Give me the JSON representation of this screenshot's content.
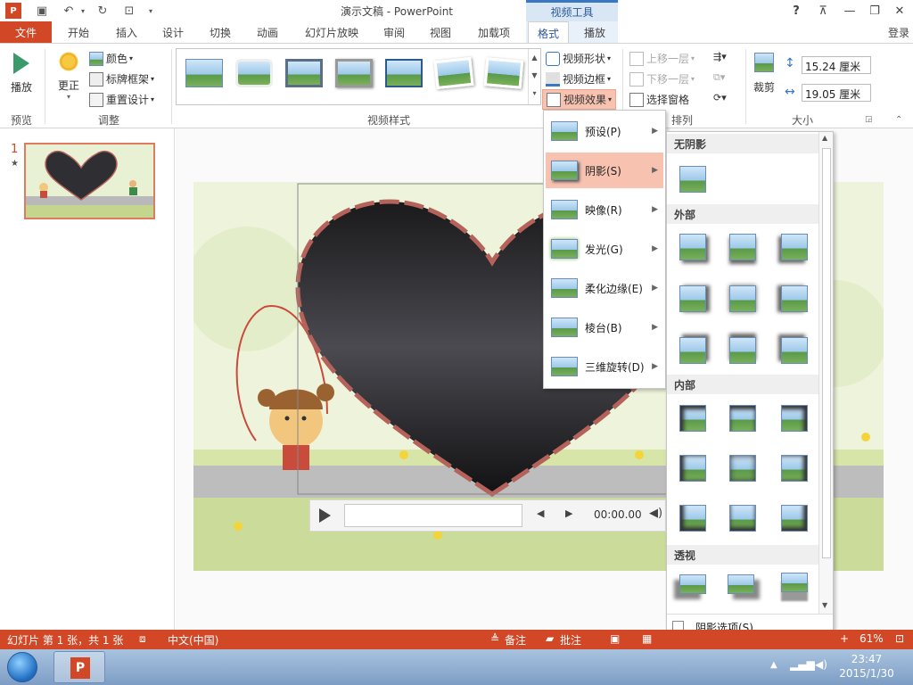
{
  "titlebar": {
    "title": "演示文稿 - PowerPoint",
    "context_tools": "视频工具",
    "help": "?"
  },
  "tabs": {
    "file": "文件",
    "home": "开始",
    "insert": "插入",
    "design": "设计",
    "transitions": "切换",
    "animations": "动画",
    "slideshow": "幻灯片放映",
    "review": "审阅",
    "view": "视图",
    "addins": "加载项",
    "format": "格式",
    "playback": "播放",
    "login": "登录"
  },
  "ribbon": {
    "preview": {
      "play": "播放",
      "group": "预览"
    },
    "adjust": {
      "correct": "更正",
      "color": "颜色",
      "poster": "标牌框架",
      "reset": "重置设计",
      "group": "调整"
    },
    "styles": {
      "group": "视频样式",
      "shape": "视频形状",
      "border": "视频边框",
      "effects": "视频效果"
    },
    "arrange": {
      "forward": "上移一层",
      "backward": "下移一层",
      "selection": "选择窗格",
      "group": "排列"
    },
    "size": {
      "crop": "裁剪",
      "height": "15.24 厘米",
      "width": "19.05 厘米",
      "group": "大小"
    }
  },
  "slides_pane": {
    "number": "1",
    "star": "★"
  },
  "player": {
    "time": "00:00.00"
  },
  "effects_menu": [
    {
      "label": "预设(P)"
    },
    {
      "label": "阴影(S)"
    },
    {
      "label": "映像(R)"
    },
    {
      "label": "发光(G)"
    },
    {
      "label": "柔化边缘(E)"
    },
    {
      "label": "棱台(B)"
    },
    {
      "label": "三维旋转(D)"
    }
  ],
  "shadow_panel": {
    "no_shadow": "无阴影",
    "outer": "外部",
    "inner": "内部",
    "perspective": "透视",
    "options": "阴影选项(S)..."
  },
  "statusbar": {
    "slide_info": "幻灯片 第 1 张，共 1 张",
    "language": "中文(中国)",
    "notes": "备注",
    "comments": "批注",
    "zoom": "61%"
  },
  "taskbar": {
    "time": "23:47",
    "date": "2015/1/30"
  },
  "colors": {
    "accent": "#d24726",
    "context": "#3a78c2",
    "highlight": "#f8c2b0"
  }
}
